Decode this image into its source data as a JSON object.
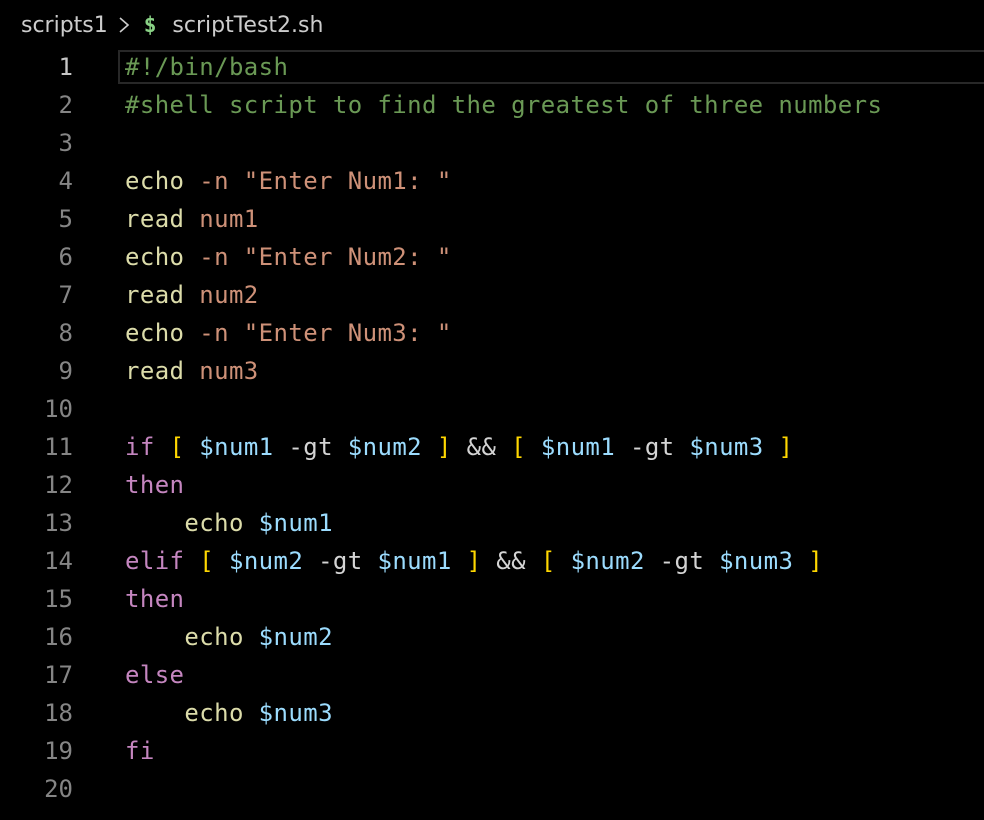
{
  "breadcrumb": {
    "folder": "scripts1",
    "separator_icon": "chevron-right-icon",
    "file_icon_glyph": "$",
    "file": "scriptTest2.sh"
  },
  "editor": {
    "active_line": 1,
    "colors": {
      "comment": "#6a9955",
      "command": "#dcdcaa",
      "string": "#ce9178",
      "keyword": "#c586c0",
      "bracket": "#ffd700",
      "variable": "#9cdcfe",
      "plain": "#d4d4d4"
    },
    "lines": [
      {
        "n": "1",
        "tokens": [
          {
            "t": "#!/bin/bash",
            "k": "comment"
          }
        ]
      },
      {
        "n": "2",
        "tokens": [
          {
            "t": "#shell script to find the greatest of three numbers",
            "k": "comment"
          }
        ]
      },
      {
        "n": "3",
        "tokens": []
      },
      {
        "n": "4",
        "tokens": [
          {
            "t": "echo",
            "k": "cmd"
          },
          {
            "t": " -n \"Enter Num1: \"",
            "k": "str"
          }
        ]
      },
      {
        "n": "5",
        "tokens": [
          {
            "t": "read",
            "k": "cmd"
          },
          {
            "t": " num1",
            "k": "str"
          }
        ]
      },
      {
        "n": "6",
        "tokens": [
          {
            "t": "echo",
            "k": "cmd"
          },
          {
            "t": " -n \"Enter Num2: \"",
            "k": "str"
          }
        ]
      },
      {
        "n": "7",
        "tokens": [
          {
            "t": "read",
            "k": "cmd"
          },
          {
            "t": " num2",
            "k": "str"
          }
        ]
      },
      {
        "n": "8",
        "tokens": [
          {
            "t": "echo",
            "k": "cmd"
          },
          {
            "t": " -n \"Enter Num3: \"",
            "k": "str"
          }
        ]
      },
      {
        "n": "9",
        "tokens": [
          {
            "t": "read",
            "k": "cmd"
          },
          {
            "t": " num3",
            "k": "str"
          }
        ]
      },
      {
        "n": "10",
        "tokens": []
      },
      {
        "n": "11",
        "tokens": [
          {
            "t": "if",
            "k": "kw"
          },
          {
            "t": " ",
            "k": "plain"
          },
          {
            "t": "[",
            "k": "bracket"
          },
          {
            "t": " ",
            "k": "plain"
          },
          {
            "t": "$num1",
            "k": "var"
          },
          {
            "t": " -gt ",
            "k": "plain"
          },
          {
            "t": "$num2",
            "k": "var"
          },
          {
            "t": " ",
            "k": "plain"
          },
          {
            "t": "]",
            "k": "bracket"
          },
          {
            "t": " && ",
            "k": "plain"
          },
          {
            "t": "[",
            "k": "bracket"
          },
          {
            "t": " ",
            "k": "plain"
          },
          {
            "t": "$num1",
            "k": "var"
          },
          {
            "t": " -gt ",
            "k": "plain"
          },
          {
            "t": "$num3",
            "k": "var"
          },
          {
            "t": " ",
            "k": "plain"
          },
          {
            "t": "]",
            "k": "bracket"
          }
        ]
      },
      {
        "n": "12",
        "tokens": [
          {
            "t": "then",
            "k": "kw"
          }
        ]
      },
      {
        "n": "13",
        "tokens": [
          {
            "t": "    ",
            "k": "plain"
          },
          {
            "t": "echo",
            "k": "cmd"
          },
          {
            "t": " ",
            "k": "plain"
          },
          {
            "t": "$num1",
            "k": "var"
          }
        ]
      },
      {
        "n": "14",
        "tokens": [
          {
            "t": "elif",
            "k": "kw"
          },
          {
            "t": " ",
            "k": "plain"
          },
          {
            "t": "[",
            "k": "bracket"
          },
          {
            "t": " ",
            "k": "plain"
          },
          {
            "t": "$num2",
            "k": "var"
          },
          {
            "t": " -gt ",
            "k": "plain"
          },
          {
            "t": "$num1",
            "k": "var"
          },
          {
            "t": " ",
            "k": "plain"
          },
          {
            "t": "]",
            "k": "bracket"
          },
          {
            "t": " && ",
            "k": "plain"
          },
          {
            "t": "[",
            "k": "bracket"
          },
          {
            "t": " ",
            "k": "plain"
          },
          {
            "t": "$num2",
            "k": "var"
          },
          {
            "t": " -gt ",
            "k": "plain"
          },
          {
            "t": "$num3",
            "k": "var"
          },
          {
            "t": " ",
            "k": "plain"
          },
          {
            "t": "]",
            "k": "bracket"
          }
        ]
      },
      {
        "n": "15",
        "tokens": [
          {
            "t": "then",
            "k": "kw"
          }
        ]
      },
      {
        "n": "16",
        "tokens": [
          {
            "t": "    ",
            "k": "plain"
          },
          {
            "t": "echo",
            "k": "cmd"
          },
          {
            "t": " ",
            "k": "plain"
          },
          {
            "t": "$num2",
            "k": "var"
          }
        ]
      },
      {
        "n": "17",
        "tokens": [
          {
            "t": "else",
            "k": "kw"
          }
        ]
      },
      {
        "n": "18",
        "tokens": [
          {
            "t": "    ",
            "k": "plain"
          },
          {
            "t": "echo",
            "k": "cmd"
          },
          {
            "t": " ",
            "k": "plain"
          },
          {
            "t": "$num3",
            "k": "var"
          }
        ]
      },
      {
        "n": "19",
        "tokens": [
          {
            "t": "fi",
            "k": "kw"
          }
        ]
      },
      {
        "n": "20",
        "tokens": []
      }
    ]
  }
}
